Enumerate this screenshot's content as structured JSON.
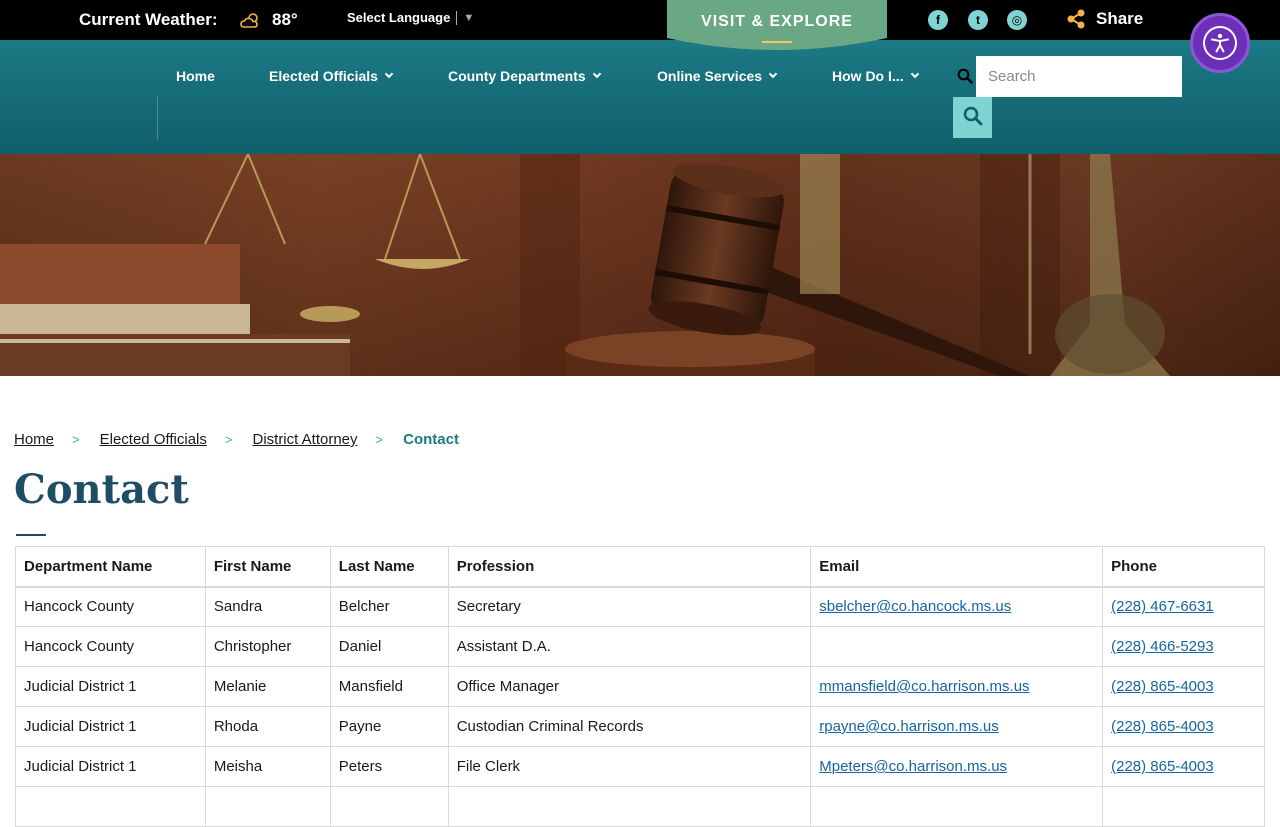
{
  "topbar": {
    "weather_label": "Current Weather:",
    "weather_icon": "partly-cloudy-icon",
    "weather_temp": "88°",
    "language_label": "Select Language",
    "language_arrow": "▼",
    "visit_label": "VISIT & EXPLORE",
    "social": [
      {
        "icon": "facebook-icon",
        "glyph": "f"
      },
      {
        "icon": "twitter-icon",
        "glyph": "t"
      },
      {
        "icon": "instagram-icon",
        "glyph": "◎"
      }
    ],
    "share_label": "Share"
  },
  "nav": {
    "items": [
      {
        "label": "Home",
        "dropdown": false
      },
      {
        "label": "Elected Officials",
        "dropdown": true
      },
      {
        "label": "County Departments",
        "dropdown": true
      },
      {
        "label": "Online Services",
        "dropdown": true
      },
      {
        "label": "How Do I...",
        "dropdown": true
      }
    ],
    "search_placeholder": "Search"
  },
  "breadcrumb": {
    "items": [
      "Home",
      "Elected Officials",
      "District Attorney"
    ],
    "separator": ">",
    "current": "Contact"
  },
  "page": {
    "title": "Contact"
  },
  "table": {
    "headers": [
      "Department Name",
      "First Name",
      "Last Name",
      "Profession",
      "Email",
      "Phone"
    ],
    "rows": [
      [
        "Hancock County",
        "Sandra",
        "Belcher",
        "Secretary",
        "sbelcher@co.hancock.ms.us",
        "(228) 467-6631"
      ],
      [
        "Hancock County",
        "Christopher",
        "Daniel",
        "Assistant D.A.",
        "",
        "(228) 466-5293"
      ],
      [
        "Judicial District 1",
        "Melanie",
        "Mansfield",
        "Office Manager",
        "mmansfield@co.harrison.ms.us",
        "(228) 865-4003"
      ],
      [
        "Judicial District 1",
        "Rhoda",
        "Payne",
        "Custodian Criminal Records",
        "rpayne@co.harrison.ms.us",
        "(228) 865-4003"
      ],
      [
        "Judicial District 1",
        "Meisha",
        "Peters",
        "File Clerk",
        "Mpeters@co.harrison.ms.us",
        "(228) 865-4003"
      ],
      [
        "",
        "",
        "",
        "",
        "",
        ""
      ]
    ]
  },
  "colors": {
    "topbar": "#000000",
    "nav": "#156a76",
    "visit_tab": "#6aa784",
    "accent_teal": "#7fd3d0",
    "title": "#1f4d63",
    "link": "#1565a0",
    "a11y": "#6b2fb8"
  }
}
